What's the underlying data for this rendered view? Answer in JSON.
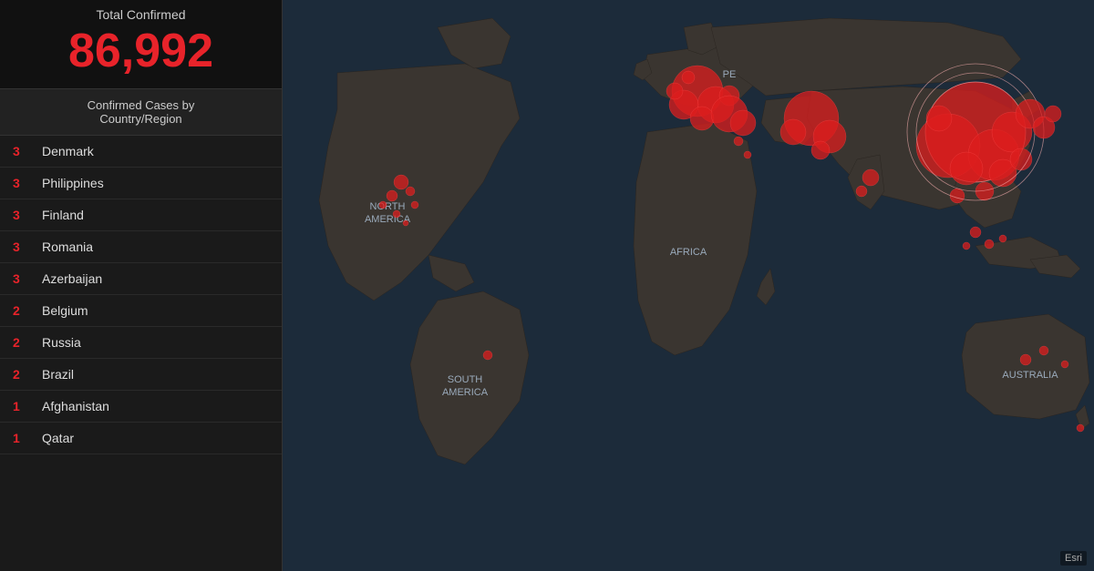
{
  "header": {
    "total_confirmed_label": "Total Confirmed",
    "total_confirmed_value": "86,992"
  },
  "sidebar": {
    "cases_by_country_label": "Confirmed Cases by\nCountry/Region",
    "countries": [
      {
        "count": "3",
        "name": "Denmark"
      },
      {
        "count": "3",
        "name": "Philippines"
      },
      {
        "count": "3",
        "name": "Finland"
      },
      {
        "count": "3",
        "name": "Romania"
      },
      {
        "count": "3",
        "name": "Azerbaijan"
      },
      {
        "count": "2",
        "name": "Belgium"
      },
      {
        "count": "2",
        "name": "Russia"
      },
      {
        "count": "2",
        "name": "Brazil"
      },
      {
        "count": "1",
        "name": "Afghanistan"
      },
      {
        "count": "1",
        "name": "Qatar"
      }
    ]
  },
  "map": {
    "labels": [
      {
        "id": "north-america",
        "text": "NORTH\nAMERICA"
      },
      {
        "id": "south-america",
        "text": "SOUTH\nAMERICA"
      },
      {
        "id": "africa",
        "text": "AFRICA"
      },
      {
        "id": "europe-label",
        "text": "PE"
      },
      {
        "id": "australia",
        "text": "AUSTRALIA"
      }
    ]
  },
  "esri": {
    "badge_text": "Esri"
  }
}
